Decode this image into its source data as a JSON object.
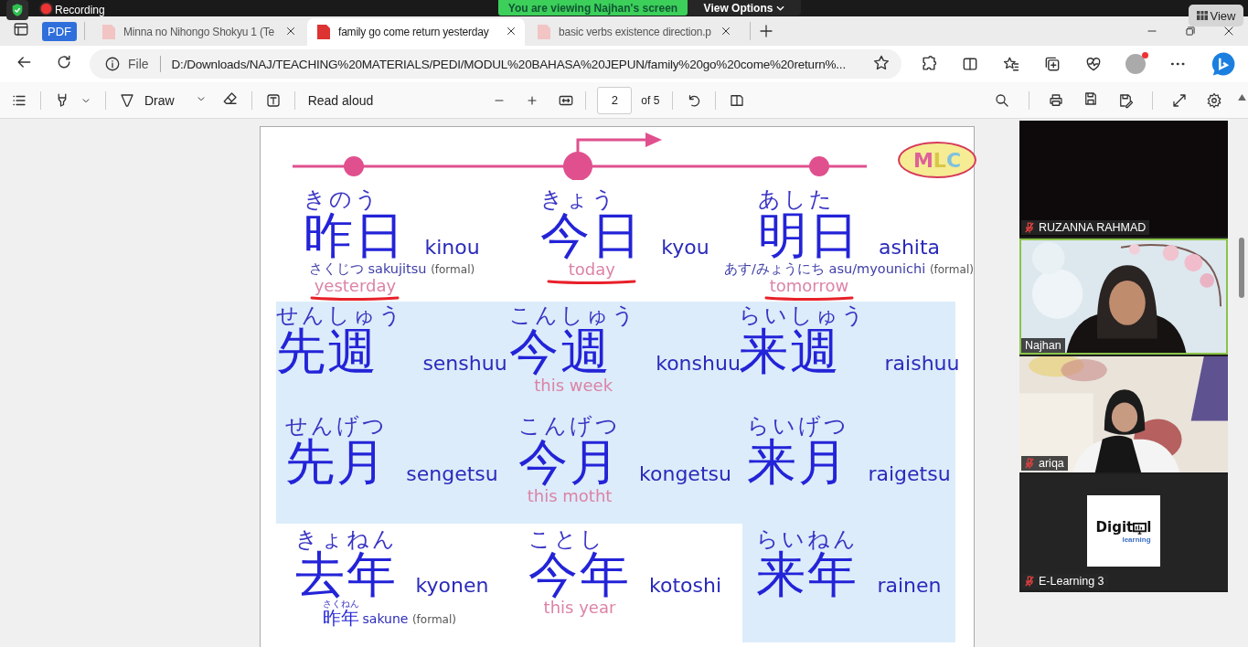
{
  "zoom_bar": {
    "recording": "Recording",
    "banner": "You are viewing Najhan's screen",
    "view_options": "View Options",
    "view_button": "View"
  },
  "pdf_badge": "PDF",
  "tabs": [
    {
      "title": "Minna no Nihongo Shokyu 1 (Te",
      "selected": false
    },
    {
      "title": "family go come return yesterday",
      "selected": true
    },
    {
      "title": "basic verbs existence direction.p",
      "selected": false
    }
  ],
  "address": {
    "scheme": "File",
    "url": "D:/Downloads/NAJ/TEACHING%20MATERIALS/PEDI/MODUL%20BAHASA%20JEPUN/family%20go%20come%20return%..."
  },
  "pdf_toolbar": {
    "draw": "Draw",
    "read_aloud": "Read aloud",
    "page": "2",
    "page_count": "of 5"
  },
  "slide": {
    "logo": "MLC",
    "rows": [
      {
        "cells": [
          {
            "kana": "きのう",
            "kanji": "昨日",
            "romaji": "kinou",
            "formal": {
              "kind": "inline",
              "kana": "さくじつ",
              "reading": "sakujitsu",
              "note": "(formal)"
            },
            "meaning": "yesterday",
            "underlined": true,
            "shaded": false
          },
          {
            "kana": "きょう",
            "kanji": "今日",
            "romaji": "kyou",
            "meaning": "today",
            "underlined": true,
            "shaded": false
          },
          {
            "kana": "あした",
            "kanji": "明日",
            "romaji": "ashita",
            "formal": {
              "kind": "inline",
              "kana": "あす/みょうにち",
              "reading": "asu/myounichi",
              "note": "(formal)"
            },
            "meaning": "tomorrow",
            "underlined": true,
            "shaded": false
          }
        ]
      },
      {
        "cells": [
          {
            "kana": "せんしゅう",
            "kanji": "先週",
            "romaji": "senshuu",
            "underlined": false,
            "shaded": true
          },
          {
            "kana": "こんしゅう",
            "kanji": "今週",
            "romaji": "konshuu",
            "meaning": "this week",
            "underlined": false,
            "shaded": true
          },
          {
            "kana": "らいしゅう",
            "kanji": "来週",
            "romaji": "raishuu",
            "underlined": false,
            "shaded": true
          }
        ]
      },
      {
        "cells": [
          {
            "kana": "せんげつ",
            "kanji": "先月",
            "romaji": "sengetsu",
            "underlined": false,
            "shaded": true
          },
          {
            "kana": "こんげつ",
            "kanji": "今月",
            "romaji": "kongetsu",
            "meaning": "this motht",
            "underlined": false,
            "shaded": true
          },
          {
            "kana": "らいげつ",
            "kanji": "来月",
            "romaji": "raigetsu",
            "underlined": false,
            "shaded": true
          }
        ]
      },
      {
        "cells": [
          {
            "kana": "きょねん",
            "kanji": "去年",
            "romaji": "kyonen",
            "formal": {
              "kind": "ruby",
              "kana": "さくねん",
              "kanji": "昨年",
              "reading": "sakune",
              "note": "(formal)"
            },
            "underlined": false,
            "shaded": false
          },
          {
            "kana": "ことし",
            "kanji": "今年",
            "romaji": "kotoshi",
            "meaning": "this year",
            "underlined": false,
            "shaded": false
          },
          {
            "kana": "らいねん",
            "kanji": "来年",
            "romaji": "rainen",
            "underlined": false,
            "shaded": true
          }
        ]
      }
    ]
  },
  "participants": [
    {
      "name": "RUZANNA RAHMAD",
      "muted": true,
      "speaking": false,
      "kind": "video-off"
    },
    {
      "name": "Najhan",
      "muted": false,
      "speaking": true,
      "kind": "camera"
    },
    {
      "name": "ariqa",
      "muted": true,
      "speaking": false,
      "kind": "camera"
    },
    {
      "name": "E-Learning 3",
      "muted": true,
      "speaking": false,
      "kind": "logo",
      "logo": {
        "parts": [
          "Digit",
          "l"
        ],
        "tagline": "learning"
      }
    }
  ]
}
